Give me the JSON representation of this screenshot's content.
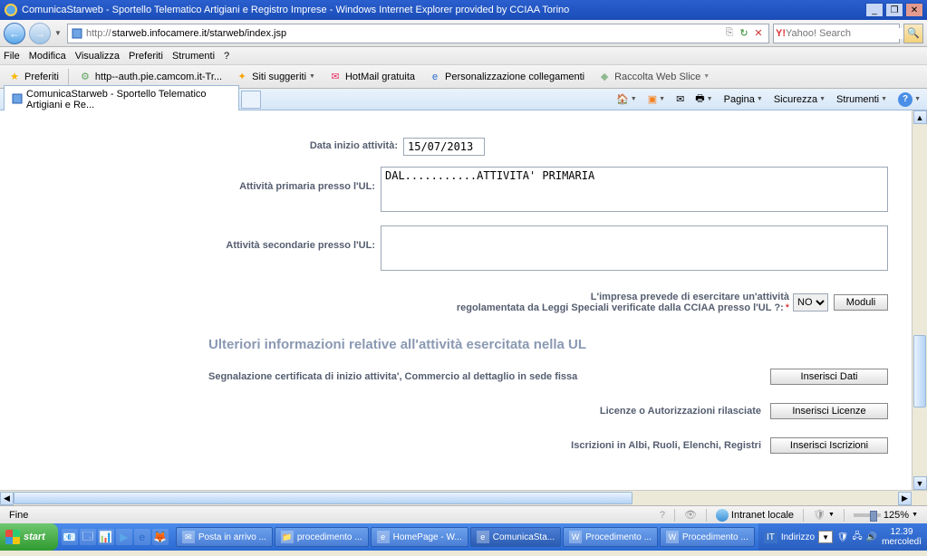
{
  "window": {
    "title": "ComunicaStarweb - Sportello Telematico Artigiani e Registro Imprese - Windows Internet Explorer provided by CCIAA Torino"
  },
  "nav": {
    "url_prefix": "http://",
    "url": "starweb.infocamere.it/starweb/index.jsp",
    "search_placeholder": "Yahoo! Search"
  },
  "menu": {
    "file": "File",
    "modifica": "Modifica",
    "visualizza": "Visualizza",
    "preferiti": "Preferiti",
    "strumenti": "Strumenti",
    "help": "?"
  },
  "toolbar": {
    "preferiti": "Preferiti",
    "auth_link": "http--auth.pie.camcom.it-Tr...",
    "siti": "Siti suggeriti",
    "hotmail": "HotMail gratuita",
    "personal": "Personalizzazione collegamenti",
    "raccolta": "Raccolta Web Slice"
  },
  "tab": {
    "label": "ComunicaStarweb - Sportello Telematico Artigiani e Re..."
  },
  "cmdbar": {
    "pagina": "Pagina",
    "sicurezza": "Sicurezza",
    "strumenti": "Strumenti"
  },
  "form": {
    "data_inizio_lbl": "Data inizio attività:",
    "data_inizio_val": "15/07/2013",
    "attivita_primaria_lbl": "Attività primaria presso l'UL:",
    "attivita_primaria_val": "DAL...........ATTIVITA' PRIMARIA",
    "attivita_secondarie_lbl": "Attività secondarie presso l'UL:",
    "attivita_secondarie_val": "",
    "regolamentata_line1": "L'impresa prevede di esercitare un'attività",
    "regolamentata_line2": "regolamentata da Leggi Speciali verificate dalla CCIAA presso l'UL ?:",
    "regolamentata_sel": "NO",
    "moduli_btn": "Moduli",
    "section_hdr": "Ulteriori informazioni relative all'attività esercitata nella UL",
    "scia_lbl": "Segnalazione certificata di inizio attivita', Commercio al dettaglio in sede fissa",
    "scia_btn": "Inserisci Dati",
    "licenze_lbl": "Licenze o Autorizzazioni rilasciate",
    "licenze_btn": "Inserisci Licenze",
    "albi_lbl": "Iscrizioni in Albi, Ruoli, Elenchi, Registri",
    "albi_btn": "Inserisci Iscrizioni"
  },
  "status": {
    "fine": "Fine",
    "intranet": "Intranet locale",
    "zoom": "125%"
  },
  "taskbar": {
    "start": "start",
    "items": [
      "Posta in arrivo ...",
      "procedimento ...",
      "HomePage - W...",
      "ComunicaSta...",
      "Procedimento ...",
      "Procedimento ..."
    ],
    "lang": "IT",
    "indirizzo": "Indirizzo",
    "time": "12.39",
    "day": "mercoledì"
  }
}
